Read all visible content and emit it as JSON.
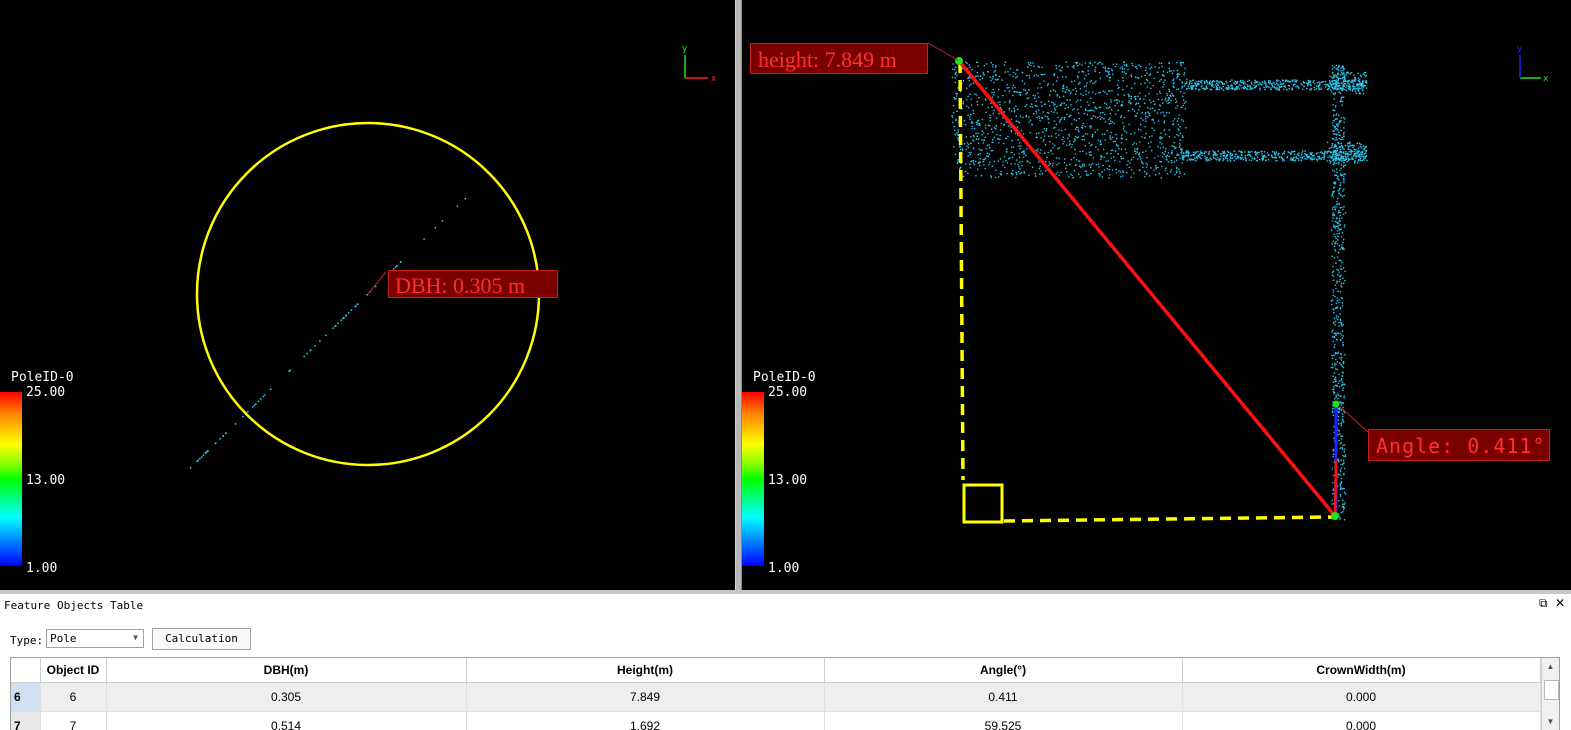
{
  "left_view": {
    "dbh_label": "DBH: 0.305 m",
    "scale": {
      "title": "PoleID-0",
      "max": "25.00",
      "mid": "13.00",
      "min": "1.00"
    },
    "axis": {
      "x": "x",
      "y": "y"
    }
  },
  "right_view": {
    "height_label": "height: 7.849 m",
    "angle_label": "Angle: 0.411°",
    "scale": {
      "title": "PoleID-0",
      "max": "25.00",
      "mid": "13.00",
      "min": "1.00"
    },
    "axis": {
      "x": "x",
      "y": "y"
    }
  },
  "colors": {
    "point_cloud": "#2bc7ee",
    "circle": "#ffff00",
    "label_bg": "#7a0000",
    "label_text": "#ff3030"
  },
  "panel": {
    "title": "Feature Objects Table",
    "type_label": "Type:",
    "type_value": "Pole",
    "calc_button": "Calculation",
    "icons": [
      "restore-icon",
      "close-icon"
    ]
  },
  "table": {
    "headers": [
      "Object ID",
      "DBH(m)",
      "Height(m)",
      "Angle(°)",
      "CrownWidth(m)"
    ],
    "rows": [
      {
        "row_header": "6",
        "cells": [
          "6",
          "0.305",
          "7.849",
          "0.411",
          "0.000"
        ]
      },
      {
        "row_header": "7",
        "cells": [
          "7",
          "0.514",
          "1.692",
          "59.525",
          "0.000"
        ]
      }
    ]
  }
}
